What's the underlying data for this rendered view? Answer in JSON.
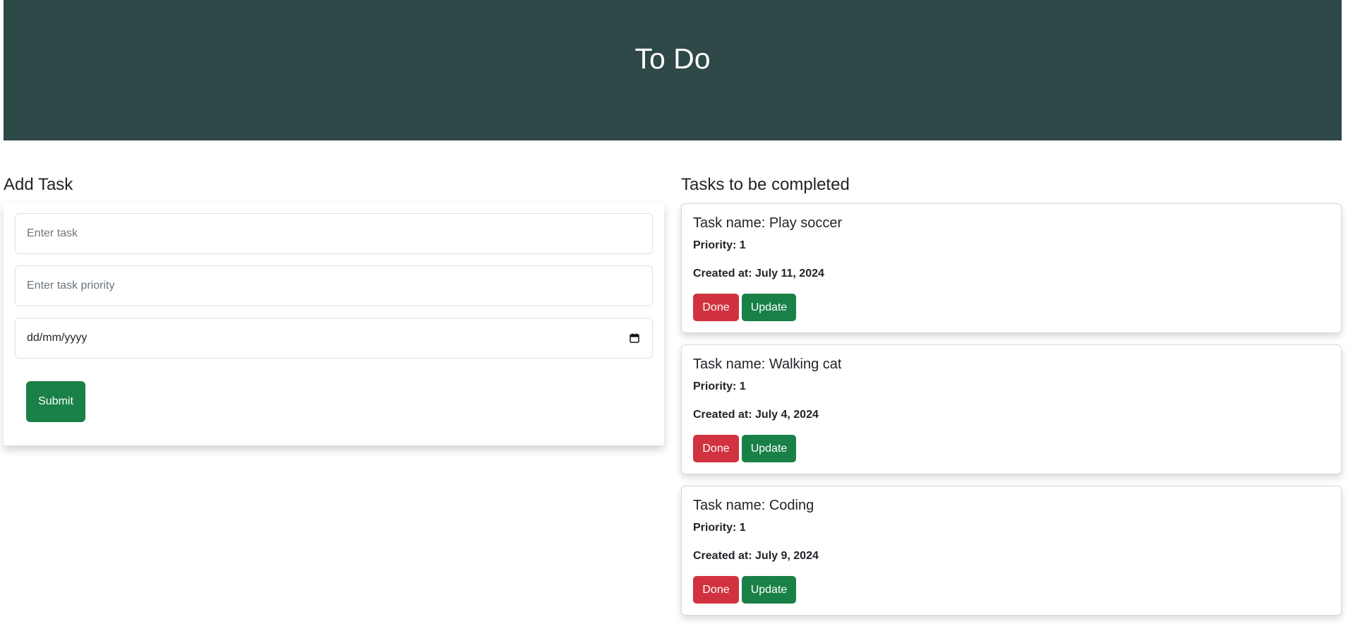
{
  "header": {
    "title": "To Do"
  },
  "add_task": {
    "title": "Add Task",
    "task_placeholder": "Enter task",
    "priority_placeholder": "Enter task priority",
    "date_placeholder": "dd/mm/yyyy",
    "submit_label": "Submit"
  },
  "task_list": {
    "title": "Tasks to be completed",
    "tasks": [
      {
        "name": "Task name: Play soccer",
        "priority": "Priority: 1",
        "created": "Created at: July 11, 2024",
        "done_label": "Done",
        "update_label": "Update"
      },
      {
        "name": "Task name: Walking cat",
        "priority": "Priority: 1",
        "created": "Created at: July 4, 2024",
        "done_label": "Done",
        "update_label": "Update"
      },
      {
        "name": "Task name: Coding",
        "priority": "Priority: 1",
        "created": "Created at: July 9, 2024",
        "done_label": "Done",
        "update_label": "Update"
      }
    ]
  },
  "colors": {
    "header_bg": "#2f4848",
    "success": "#198047",
    "danger": "#d1323f"
  },
  "icons": {
    "date_picker": "calendar-icon"
  }
}
